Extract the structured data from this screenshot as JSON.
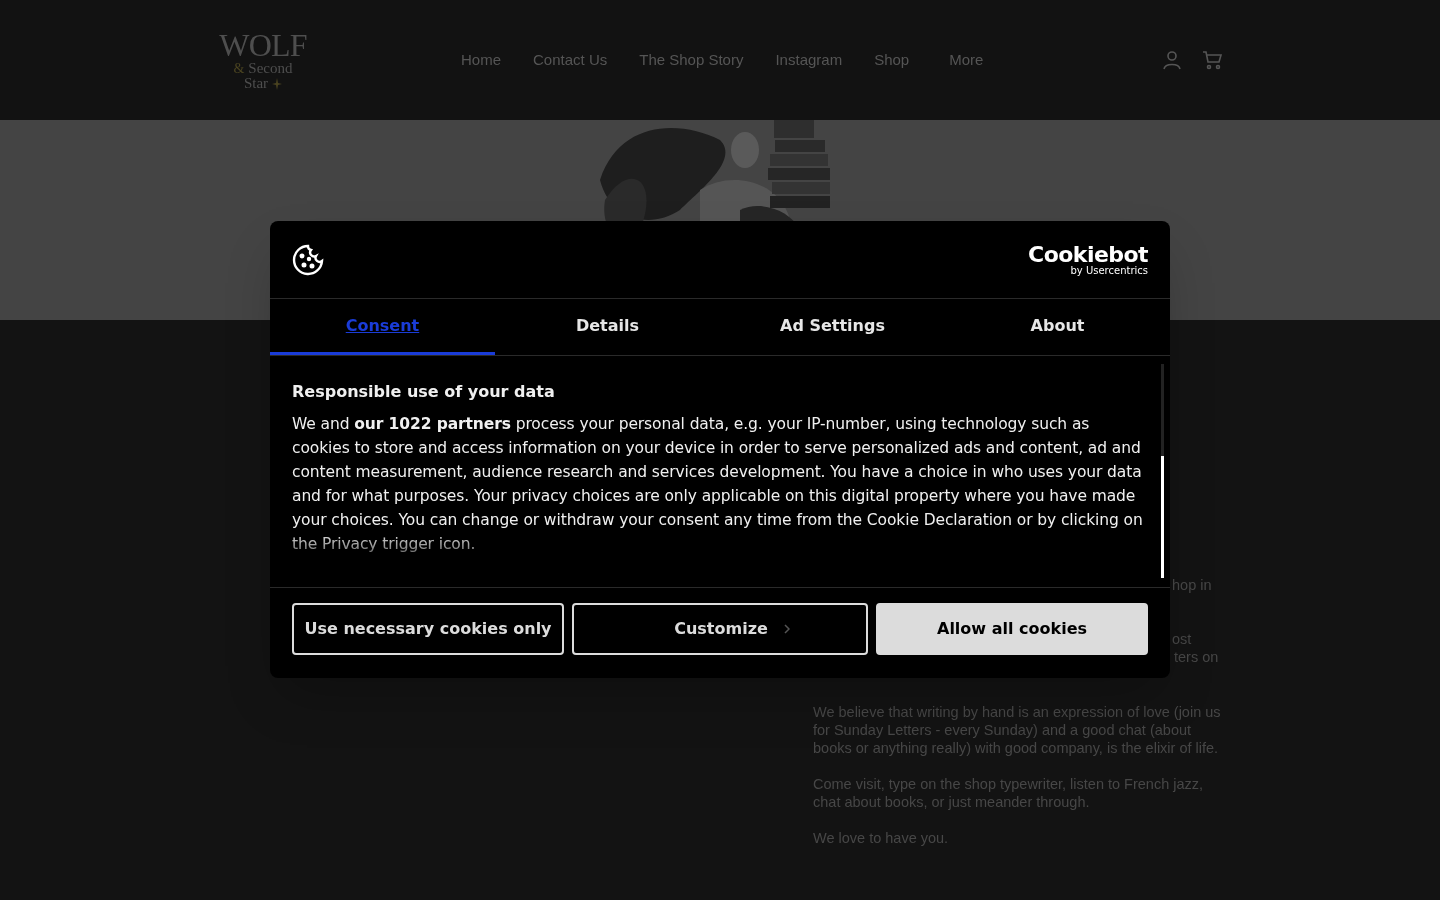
{
  "site": {
    "logo": {
      "line1": "WOLF",
      "line2": "&",
      "line3": "Second",
      "line4": "Star"
    },
    "nav": [
      {
        "label": "Home"
      },
      {
        "label": "Contact Us"
      },
      {
        "label": "The Shop Story"
      },
      {
        "label": "Instagram"
      },
      {
        "label": "Shop"
      },
      {
        "label": "More"
      }
    ],
    "hero": {
      "kind": "picture"
    },
    "fragments": [
      "hop in",
      "ost",
      "ters on"
    ],
    "paragraphs": [
      "We believe that writing by hand is an expression of love (join us for Sunday Letters - every Sunday) and a good chat (about books or anything really) with good company, is the elixir of life.",
      "Come visit, type on the shop typewriter, listen to French jazz, chat about books, or just meander through.",
      "We love to have you."
    ]
  },
  "dialog": {
    "brand": {
      "name": "Cookiebot",
      "byline": "by Usercentrics"
    },
    "tabs": [
      {
        "label": "Consent",
        "selected": true
      },
      {
        "label": "Details",
        "selected": false
      },
      {
        "label": "Ad Settings",
        "selected": false
      },
      {
        "label": "About",
        "selected": false
      }
    ],
    "heading": "Responsible use of your data",
    "body": "We and **our 1022 partners** process your personal data, e.g. your IP-number, using technology such as cookies to store and access information on your device in order to serve personalized ads and content, ad and content measurement, audience research and services development. You have a choice in who uses your data and for what purposes. Your privacy choices are only applicable on this digital property where you have made your choices. You can change or withdraw your consent any time from the Cookie Declaration or by clicking on the Privacy trigger icon.",
    "buttons": [
      {
        "label": "Use necessary cookies only",
        "kind": "outline"
      },
      {
        "label": "Customize",
        "kind": "chevron"
      },
      {
        "label": "Allow all cookies",
        "kind": "filled"
      }
    ]
  }
}
